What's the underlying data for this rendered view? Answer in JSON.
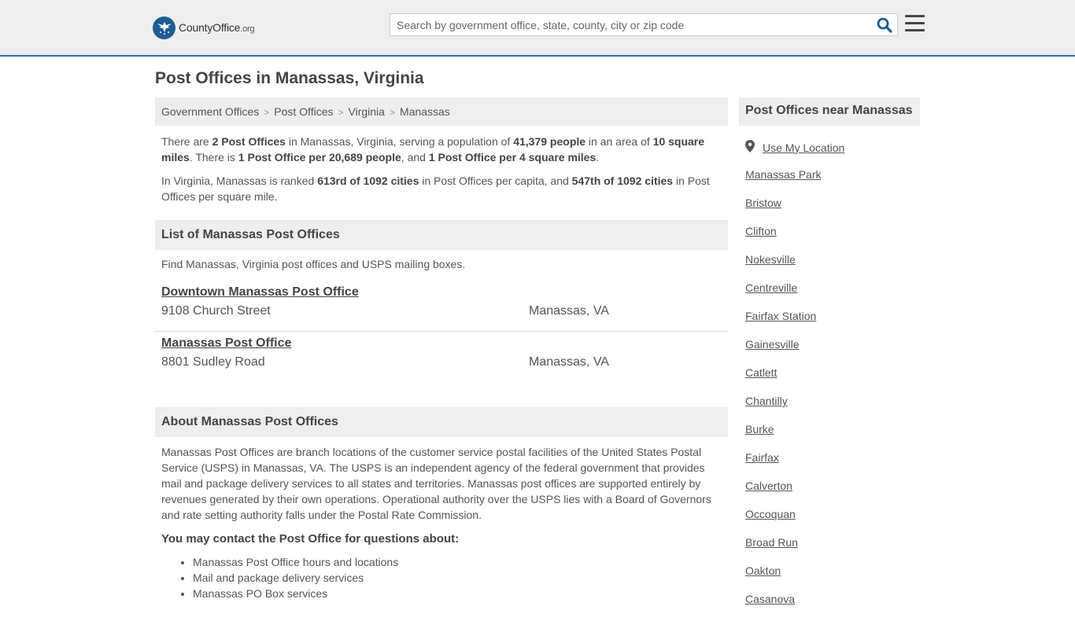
{
  "header": {
    "logo_text": "CountyOffice",
    "logo_tld": ".org",
    "search_placeholder": "Search by government office, state, county, city or zip code"
  },
  "page_title": "Post Offices in Manassas, Virginia",
  "breadcrumb": [
    "Government Offices",
    "Post Offices",
    "Virginia",
    "Manassas"
  ],
  "intro": {
    "p1": [
      {
        "t": "There are ",
        "b": false
      },
      {
        "t": "2 Post Offices",
        "b": true
      },
      {
        "t": " in Manassas, Virginia, serving a population of ",
        "b": false
      },
      {
        "t": "41,379 people",
        "b": true
      },
      {
        "t": " in an area of ",
        "b": false
      },
      {
        "t": "10 square miles",
        "b": true
      },
      {
        "t": ". There is ",
        "b": false
      },
      {
        "t": "1 Post Office per 20,689 people",
        "b": true
      },
      {
        "t": ", and ",
        "b": false
      },
      {
        "t": "1 Post Office per 4 square miles",
        "b": true
      },
      {
        "t": ".",
        "b": false
      }
    ],
    "p2": [
      {
        "t": "In Virginia, Manassas is ranked ",
        "b": false
      },
      {
        "t": "613rd of 1092 cities",
        "b": true
      },
      {
        "t": " in Post Offices per capita, and ",
        "b": false
      },
      {
        "t": "547th of 1092 cities",
        "b": true
      },
      {
        "t": " in Post Offices per square mile.",
        "b": false
      }
    ]
  },
  "list_section": {
    "title": "List of Manassas Post Offices",
    "description": "Find Manassas, Virginia post offices and USPS mailing boxes.",
    "offices": [
      {
        "name": "Downtown Manassas Post Office",
        "address": "9108 Church Street",
        "city": "Manassas, VA"
      },
      {
        "name": "Manassas Post Office",
        "address": "8801 Sudley Road",
        "city": "Manassas, VA"
      }
    ]
  },
  "about_section": {
    "title": "About Manassas Post Offices",
    "text": "Manassas Post Offices are branch locations of the customer service postal facilities of the United States Postal Service (USPS) in Manassas, VA. The USPS is an independent agency of the federal government that provides mail and package delivery services to all states and territories. Manassas post offices are supported entirely by revenues generated by their own operations. Operational authority over the USPS lies with a Board of Governors and rate setting authority falls under the Postal Rate Commission.",
    "contact_heading": "You may contact the Post Office for questions about:",
    "contact_items": [
      "Manassas Post Office hours and locations",
      "Mail and package delivery services",
      "Manassas PO Box services"
    ]
  },
  "sidebar": {
    "title": "Post Offices near Manassas",
    "use_location": "Use My Location",
    "nearby": [
      "Manassas Park",
      "Bristow",
      "Clifton",
      "Nokesville",
      "Centreville",
      "Fairfax Station",
      "Gainesville",
      "Catlett",
      "Chantilly",
      "Burke",
      "Fairfax",
      "Calverton",
      "Occoquan",
      "Broad Run",
      "Oakton",
      "Casanova"
    ]
  },
  "colors": {
    "header_bg": "#eeeeee",
    "header_border": "#2f6fa8",
    "logo_blue": "#1f5b95",
    "search_icon": "#1f5b95"
  }
}
